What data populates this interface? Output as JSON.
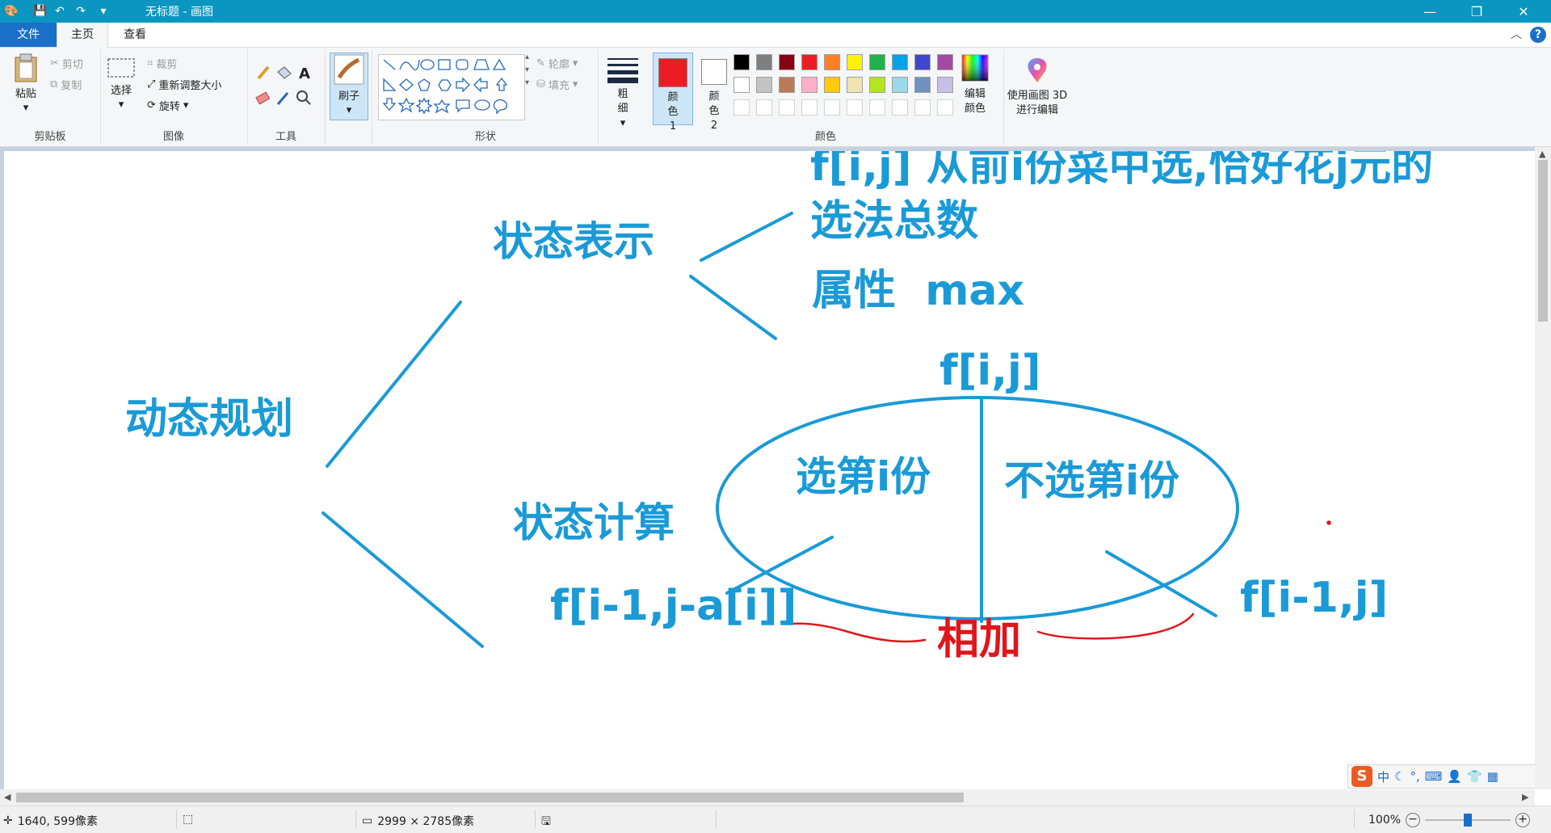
{
  "window": {
    "title": "无标题 - 画图",
    "minimize": "—",
    "maximize": "❐",
    "close": "✕"
  },
  "tabs": {
    "file": "文件",
    "home": "主页",
    "view": "查看"
  },
  "ribbon": {
    "clipboard": {
      "label": "剪贴板",
      "paste": "粘贴",
      "cut": "剪切",
      "copy": "复制"
    },
    "image": {
      "label": "图像",
      "select": "选择",
      "crop": "裁剪",
      "resize": "重新调整大小",
      "rotate": "旋转"
    },
    "tools": {
      "label": "工具"
    },
    "brushes": {
      "label": "刷子"
    },
    "shapes": {
      "label": "形状",
      "outline": "轮廓",
      "fill": "填充"
    },
    "size": {
      "label": "粗细"
    },
    "colors": {
      "label": "颜色",
      "color1": "颜色 1",
      "color2": "颜色 2",
      "edit": "编辑颜色",
      "paint3d": "使用画图 3D 进行编辑",
      "color1_value": "#ed1c24",
      "color2_value": "#ffffff",
      "palette_row1": [
        "#000000",
        "#7f7f7f",
        "#880015",
        "#ed1c24",
        "#ff7f27",
        "#fff200",
        "#22b14c",
        "#00a2e8",
        "#3f48cc",
        "#a349a4"
      ],
      "palette_row2": [
        "#ffffff",
        "#c3c3c3",
        "#b97a57",
        "#ffaec9",
        "#ffc90e",
        "#efe4b0",
        "#b5e61d",
        "#99d9ea",
        "#7092be",
        "#c8bfe7"
      ]
    }
  },
  "drawing": {
    "root": "动态规划",
    "state_repr": "状态表示",
    "state_calc": "状态计算",
    "def_line1": "f[i,j] 从前i份菜中选,恰好花j元的",
    "def_line2": "选法总数",
    "attr": "属性  max",
    "fij": "f[i,j]",
    "choose": "选第i份",
    "not_choose": "不选第i份",
    "left_term": "f[i-1,j-a[i]]",
    "right_term": "f[i-1,j]",
    "sum": "相加",
    "blue": "#1a9ad6",
    "red": "#e0161b"
  },
  "status": {
    "cursor": "1640, 599像素",
    "canvas_size": "2999 × 2785像素",
    "zoom": "100%"
  },
  "ime": {
    "mode": "中",
    "brand": "S"
  }
}
